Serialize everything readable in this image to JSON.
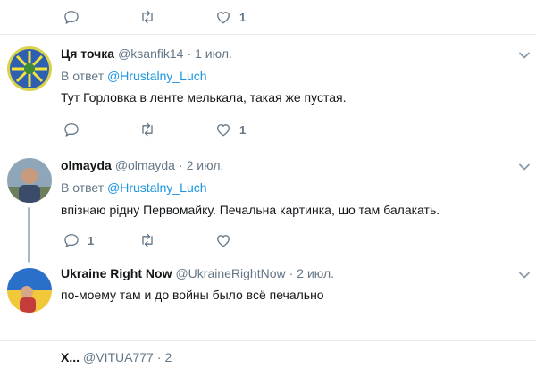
{
  "top_actions": {
    "reply_count": "",
    "retweet_count": "",
    "like_count": "1"
  },
  "tweets": [
    {
      "name": "Ця точка",
      "handle": "@ksanfik14",
      "time": "1 июл.",
      "reply_prefix": "В ответ",
      "reply_to": "@Hrustalny_Luch",
      "text": "Тут Горловка в ленте мелькала, такая же пустая.",
      "reply_count": "",
      "retweet_count": "",
      "like_count": "1"
    },
    {
      "name": "olmayda",
      "handle": "@olmayda",
      "time": "2 июл.",
      "reply_prefix": "В ответ",
      "reply_to": "@Hrustalny_Luch",
      "text": "впізнаю рідну Первомайку. Печальна картинка, шо там балакать.",
      "reply_count": "1",
      "retweet_count": "",
      "like_count": ""
    },
    {
      "name": "Ukraine Right Now",
      "handle": "@UkraineRightNow",
      "time": "2 июл.",
      "text": "по-моему там и до войны было всё печально"
    }
  ],
  "partial_next": {
    "name": "Х...",
    "handle": "@VITUA777",
    "time": "2"
  },
  "colors": {
    "link": "#1b95e0",
    "muted": "#657786",
    "divider": "#e6ecf0",
    "thread_line": "#aab8c2"
  }
}
